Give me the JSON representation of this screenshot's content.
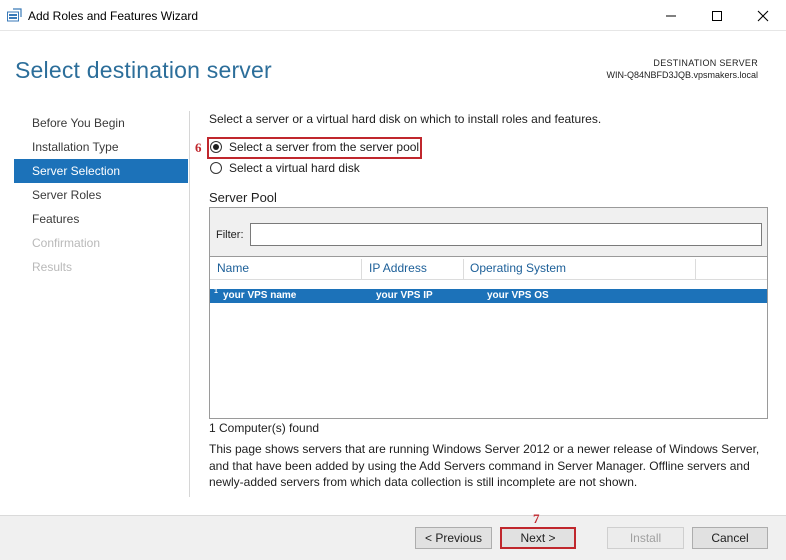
{
  "window": {
    "title": "Add Roles and Features Wizard"
  },
  "header": {
    "title": "Select destination server",
    "destination_label": "DESTINATION SERVER",
    "destination_name": "WIN-Q84NBFD3JQB.vpsmakers.local"
  },
  "nav": {
    "items": [
      {
        "label": "Before You Begin",
        "state": "normal"
      },
      {
        "label": "Installation Type",
        "state": "normal"
      },
      {
        "label": "Server Selection",
        "state": "active"
      },
      {
        "label": "Server Roles",
        "state": "normal"
      },
      {
        "label": "Features",
        "state": "normal"
      },
      {
        "label": "Confirmation",
        "state": "disabled"
      },
      {
        "label": "Results",
        "state": "disabled"
      }
    ]
  },
  "main": {
    "intro": "Select a server or a virtual hard disk on which to install roles and features.",
    "option_pool": "Select a server from the server pool",
    "option_vhd": "Select a virtual hard disk",
    "selected_option": "pool",
    "pool_title": "Server Pool",
    "filter_label": "Filter:",
    "filter_value": "",
    "columns": [
      "Name",
      "IP Address",
      "Operating System"
    ],
    "rows": [
      {
        "marker": "1",
        "name": "your VPS name",
        "ip": "your VPS IP",
        "os": "your VPS OS",
        "selected": true
      }
    ],
    "found": "1 Computer(s) found",
    "description": "This page shows servers that are running Windows Server 2012 or a newer release of Windows Server, and that have been added by using the Add Servers command in Server Manager. Offline servers and newly-added servers from which data collection is still incomplete are not shown."
  },
  "annotations": {
    "step_pool": "6",
    "step_next": "7"
  },
  "footer": {
    "previous": "< Previous",
    "next": "Next >",
    "install": "Install",
    "cancel": "Cancel"
  },
  "colors": {
    "accent": "#1c72b9",
    "title": "#2c6e9a",
    "annotation": "#c0272d"
  }
}
